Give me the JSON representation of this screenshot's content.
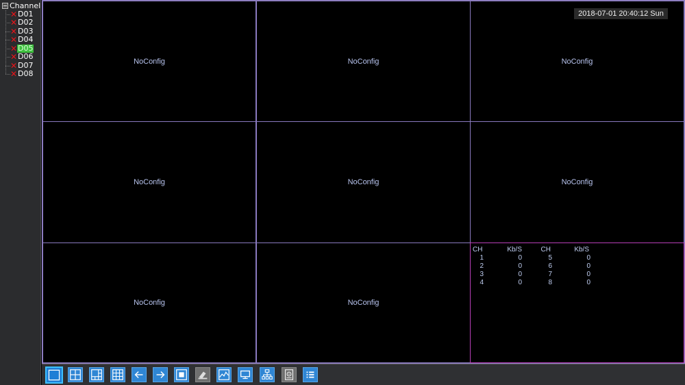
{
  "sidebar": {
    "root_label": "Channel",
    "channels": [
      {
        "label": "D01",
        "status_icon": "x-icon",
        "selected": false
      },
      {
        "label": "D02",
        "status_icon": "x-icon",
        "selected": false
      },
      {
        "label": "D03",
        "status_icon": "x-icon",
        "selected": false
      },
      {
        "label": "D04",
        "status_icon": "x-icon",
        "selected": false
      },
      {
        "label": "D05",
        "status_icon": "x-icon",
        "selected": true
      },
      {
        "label": "D06",
        "status_icon": "x-icon",
        "selected": false
      },
      {
        "label": "D07",
        "status_icon": "x-icon",
        "selected": false
      },
      {
        "label": "D08",
        "status_icon": "x-icon",
        "selected": false
      }
    ]
  },
  "datetime": "2018-07-01 20:40:12 Sun",
  "cells": [
    {
      "text": "NoConfig"
    },
    {
      "text": "NoConfig"
    },
    {
      "text": "NoConfig"
    },
    {
      "text": "NoConfig"
    },
    {
      "text": "NoConfig"
    },
    {
      "text": "NoConfig"
    },
    {
      "text": "NoConfig"
    },
    {
      "text": "NoConfig"
    }
  ],
  "stats": {
    "headers": [
      "CH",
      "Kb/S",
      "CH",
      "Kb/S"
    ],
    "rows": [
      [
        "1",
        "0",
        "5",
        "0"
      ],
      [
        "2",
        "0",
        "6",
        "0"
      ],
      [
        "3",
        "0",
        "7",
        "0"
      ],
      [
        "4",
        "0",
        "8",
        "0"
      ]
    ]
  },
  "toolbar": {
    "buttons": [
      {
        "icon": "single-view-icon",
        "active": true
      },
      {
        "icon": "quad-view-icon",
        "active": false
      },
      {
        "icon": "six-view-icon",
        "active": false
      },
      {
        "icon": "nine-view-icon",
        "active": false
      },
      {
        "icon": "arrow-left-icon",
        "active": false
      },
      {
        "icon": "arrow-right-icon",
        "active": false
      },
      {
        "icon": "fullscreen-icon",
        "active": false
      },
      {
        "icon": "ptz-icon",
        "active": false,
        "disabled": true
      },
      {
        "icon": "image-adjust-icon",
        "active": false
      },
      {
        "icon": "monitor-icon",
        "active": false
      },
      {
        "icon": "network-icon",
        "active": false
      },
      {
        "icon": "hdd-icon",
        "active": false,
        "disabled": true
      },
      {
        "icon": "menu-list-icon",
        "active": false
      }
    ]
  },
  "colors": {
    "grid_border": "#8a7ac0",
    "stats_border": "#b83fb8",
    "selected_channel": "#3fbf3f",
    "toolbar_button": "#2f86d4"
  }
}
